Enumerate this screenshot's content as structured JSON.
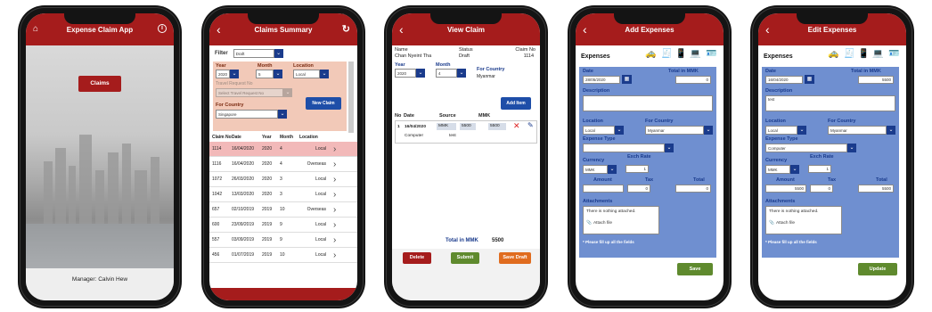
{
  "phone1": {
    "title": "Expense Claim App",
    "home_icon": "home-icon",
    "info_icon": "info-icon",
    "claims_button": "Claims",
    "manager": "Manager: Calvin Hew"
  },
  "phone2": {
    "title": "Claims Summary",
    "filter_label": "Filter",
    "filter_value": "Draft",
    "year_label": "Year",
    "month_label": "Month",
    "location_label": "Location",
    "year_value": "2020",
    "month_value": "5",
    "location_value": "Local",
    "travel_label": "Travel Request No",
    "travel_placeholder": "Select Travel Request No",
    "country_label": "For Country",
    "country_value": "Singapore",
    "new_claim": "New Claim",
    "headers": [
      "Claim No",
      "Date",
      "Year",
      "Month",
      "Location"
    ],
    "rows": [
      [
        "1114",
        "16/04/2020",
        "2020",
        "4",
        "Local"
      ],
      [
        "1116",
        "16/04/2020",
        "2020",
        "4",
        "Overseas"
      ],
      [
        "1072",
        "26/03/2020",
        "2020",
        "3",
        "Local"
      ],
      [
        "1042",
        "13/03/2020",
        "2020",
        "3",
        "Local"
      ],
      [
        "657",
        "02/10/2019",
        "2019",
        "10",
        "Overseas"
      ],
      [
        "600",
        "23/09/2019",
        "2019",
        "9",
        "Local"
      ],
      [
        "557",
        "03/09/2019",
        "2019",
        "9",
        "Local"
      ],
      [
        "456",
        "01/07/2019",
        "2019",
        "10",
        "Local"
      ]
    ]
  },
  "phone3": {
    "title": "View Claim",
    "name_label": "Name",
    "name_value": "Chan Nyeint Tha",
    "status_label": "Status",
    "status_value": "Draft",
    "claimno_label": "Claim No",
    "claimno_value": "1114",
    "year_label": "Year",
    "month_label": "Month",
    "country_label": "For Country",
    "year_value": "2020",
    "month_value": "4",
    "country_value": "Myanmar",
    "add_item": "Add Item",
    "col_no": "No",
    "col_date": "Date",
    "col_source": "Source",
    "col_mmk": "MMK",
    "item_no": "1",
    "item_date": "16/04/2020",
    "item_currency": "MMK",
    "item_amount1": "5500",
    "item_amount2": "5500",
    "item_type": "Computer",
    "item_desc": "test",
    "total_label": "Total in MMK",
    "total_value": "5500",
    "delete": "Delete",
    "submit": "Submit",
    "save_draft": "Save Draft"
  },
  "phone4": {
    "title": "Add Expenses",
    "section": "Expenses",
    "date_label": "Date",
    "total_label": "Total in MMK",
    "date_value": "28/05/2020",
    "total_value": "0",
    "desc_label": "Description",
    "desc_value": "",
    "location_label": "Location",
    "country_label": "For Country",
    "location_value": "Local",
    "country_value": "Myanmar",
    "type_label": "Expense Type",
    "type_value": "",
    "currency_label": "Currency",
    "rate_label": "Exch Rate",
    "currency_value": "MMK",
    "rate_value": "1",
    "amount_label": "Amount",
    "tax_label": "Tax",
    "totalc_label": "Total",
    "amount_value": "",
    "tax_value": "0",
    "totalc_value": "0",
    "attach_label": "Attachments",
    "attach_empty": "There is nothing attached.",
    "attach_file": "Attach file",
    "note": "* Please fill up all the fields",
    "save": "Save"
  },
  "phone5": {
    "title": "Edit Expenses",
    "section": "Expenses",
    "date_label": "Date",
    "total_label": "Total in MMK",
    "date_value": "16/04/2020",
    "total_value": "5500",
    "desc_label": "Description",
    "desc_value": "test",
    "location_label": "Location",
    "country_label": "For Country",
    "location_value": "Local",
    "country_value": "Myanmar",
    "type_label": "Expense Type",
    "type_value": "Computer",
    "currency_label": "Currency",
    "rate_label": "Exch Rate",
    "currency_value": "MMK",
    "rate_value": "1",
    "amount_label": "Amount",
    "tax_label": "Tax",
    "totalc_label": "Total",
    "amount_value": "5500",
    "tax_value": "0",
    "totalc_value": "5500",
    "attach_label": "Attachments",
    "attach_empty": "There is nothing attached.",
    "attach_file": "Attach file",
    "note": "* Please fill up all the fields",
    "update": "Update"
  },
  "colors": {
    "header_red": "#a51c1c",
    "panel_blue": "#6f8fd0",
    "label_blue": "#1a3b8c",
    "green": "#5f8a2e",
    "orange": "#e06c1f"
  }
}
